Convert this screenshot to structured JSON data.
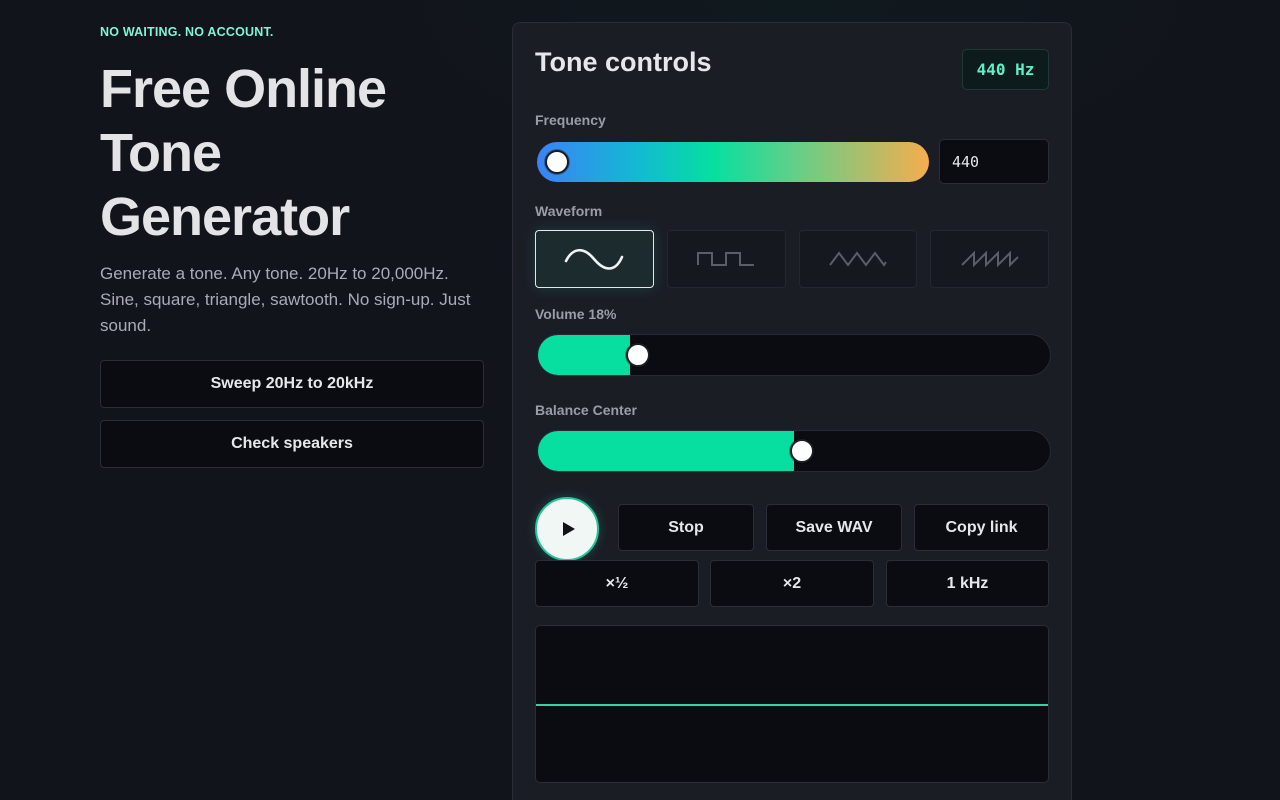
{
  "hero": {
    "eyebrow": "NO WAITING. NO ACCOUNT.",
    "title_lines": [
      "Free Online",
      "Tone",
      "Generator"
    ],
    "description": "Generate a tone. Any tone. 20Hz to 20,000Hz. Sine, square, triangle, sawtooth. No sign-up. Just sound.",
    "sweep_button": "Sweep 20Hz to 20kHz",
    "speakers_button": "Check speakers"
  },
  "panel": {
    "title": "Tone controls",
    "hz_badge": "440 Hz",
    "frequency": {
      "label": "Frequency",
      "value": "440",
      "position": 0.02
    },
    "waveform": {
      "label": "Waveform",
      "options": [
        "sine",
        "square",
        "triangle",
        "sawtooth"
      ],
      "selected": "sine"
    },
    "volume": {
      "label": "Volume 18%",
      "value": 0.18
    },
    "balance": {
      "label": "Balance Center",
      "value": 0.5
    },
    "buttons": {
      "stop": "Stop",
      "save_wav": "Save WAV",
      "copy_link": "Copy link",
      "half": "×½",
      "double": "×2",
      "one_khz": "1 kHz"
    }
  },
  "colors": {
    "accent": "#06dfa0",
    "eyebrow": "#7ff5d2",
    "background": "#12141c",
    "panel": "#1b1d25"
  }
}
